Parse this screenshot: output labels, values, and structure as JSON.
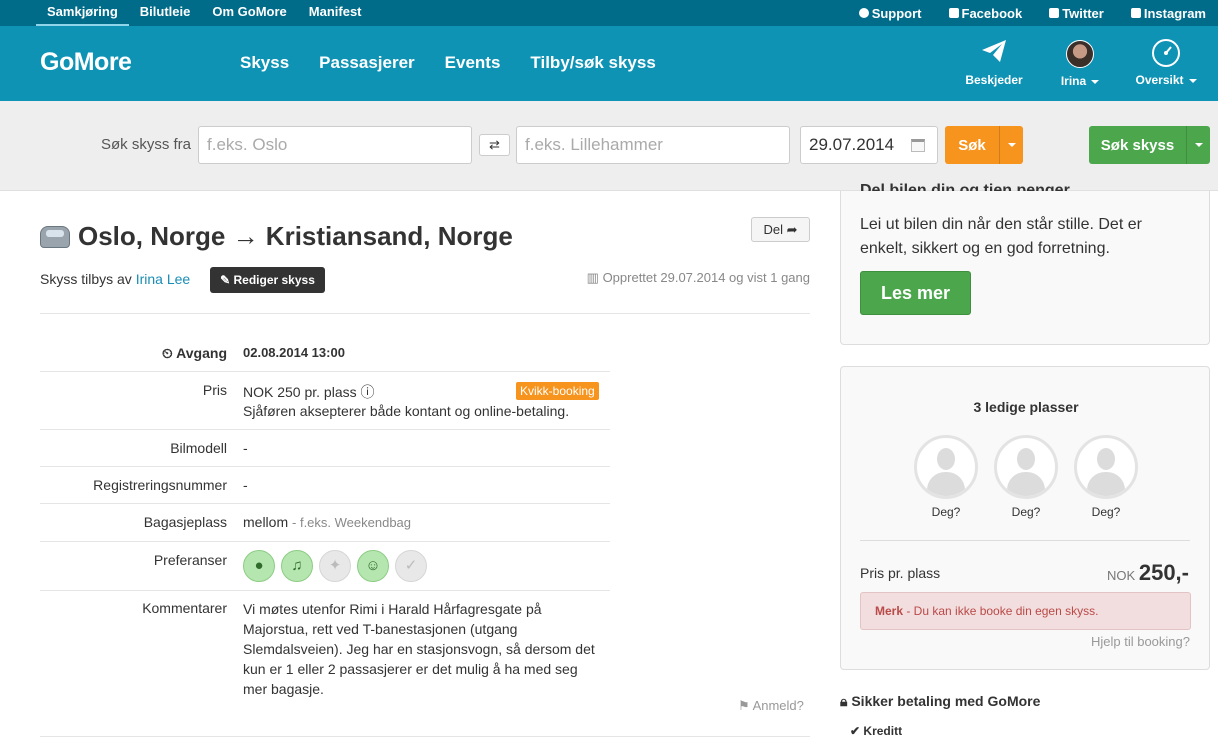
{
  "topbar": {
    "links": [
      "Samkjøring",
      "Bilutleie",
      "Om GoMore",
      "Manifest"
    ],
    "social": [
      "Support",
      "Facebook",
      "Twitter",
      "Instagram"
    ]
  },
  "header": {
    "logo": "GoMore",
    "nav": [
      "Skyss",
      "Passasjerer",
      "Events",
      "Tilby/søk skyss"
    ],
    "messages": "Beskjeder",
    "user": "Irina",
    "overview": "Oversikt"
  },
  "search": {
    "label": "Søk skyss fra",
    "from_placeholder": "f.eks. Oslo",
    "to_placeholder": "f.eks. Lillehammer",
    "date": "29.07.2014",
    "search_btn": "Søk",
    "search_rides_btn": "Søk skyss"
  },
  "ride": {
    "title": "Oslo, Norge → Kristiansand, Norge",
    "share": "Del",
    "offered_by": "Skyss tilbys av",
    "driver": "Irina Lee",
    "edit": "Rediger skyss",
    "created": "Opprettet 29.07.2014 og vist 1 gang",
    "departure_label": "Avgang",
    "departure": "02.08.2014 13:00",
    "price_label": "Pris",
    "price": "NOK 250 pr. plass",
    "quick_booking": "Kvikk-booking",
    "price_note": "Sjåføren aksepterer både kontant og online-betaling.",
    "car_label": "Bilmodell",
    "car": "-",
    "reg_label": "Registreringsnummer",
    "reg": "-",
    "luggage_label": "Bagasjeplass",
    "luggage": "mellom",
    "luggage_note": "- f.eks. Weekendbag",
    "prefs_label": "Preferanser",
    "comment_label": "Kommentarer",
    "comment": "Vi møtes utenfor Rimi i Harald Hårfagresgate på Majorstua, rett ved T-banestasjonen (utgang Slemdalsveien). Jeg har en stasjonsvogn, så dersom det kun er 1 eller 2 passasjerer er det mulig å ha med seg mer bagasje.",
    "report": "Anmeld?"
  },
  "sidebar": {
    "promo_title": "Del bilen din og tjen penger",
    "promo_text": "Lei ut bilen din når den står stille. Det er enkelt, sikkert og en god forretning.",
    "promo_btn": "Les mer",
    "seats_title": "3 ledige plasser",
    "seat_label": "Deg?",
    "price_label": "Pris pr. plass",
    "currency": "NOK",
    "price": "250,-",
    "alert_strong": "Merk",
    "alert_text": " - Du kan ikke booke din egen skyss.",
    "help": "Hjelp til booking?",
    "secure": "Sikker betaling med GoMore",
    "credit": "Kreditt"
  }
}
